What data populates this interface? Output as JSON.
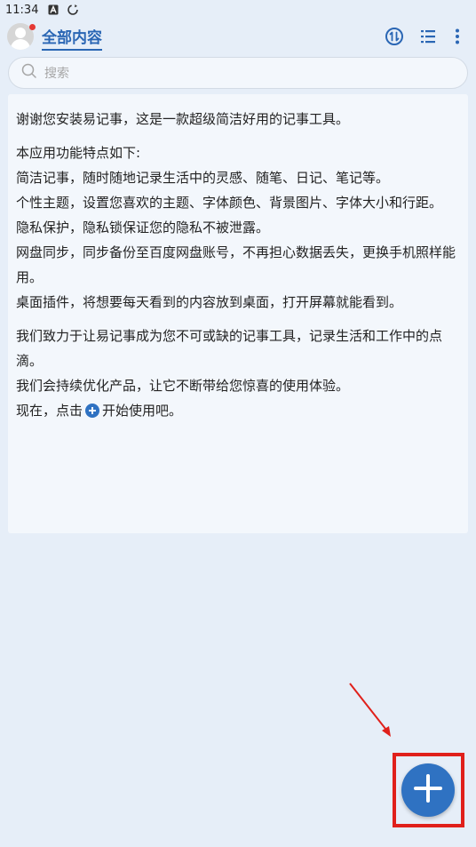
{
  "status_bar": {
    "time": "11:34",
    "icons": [
      "a-icon",
      "sync-icon"
    ]
  },
  "header": {
    "title": "全部内容",
    "has_notification": true,
    "actions": [
      "sort-icon",
      "checklist-icon",
      "more-icon"
    ]
  },
  "search": {
    "placeholder": "搜索"
  },
  "note": {
    "intro": "谢谢您安装易记事，这是一款超级简洁好用的记事工具。",
    "features_heading": "本应用功能特点如下:",
    "features": [
      "简洁记事，随时随地记录生活中的灵感、随笔、日记、笔记等。",
      "个性主题，设置您喜欢的主题、字体颜色、背景图片、字体大小和行距。",
      "隐私保护，隐私锁保证您的隐私不被泄露。",
      "网盘同步，同步备份至百度网盘账号，不再担心数据丢失，更换手机照样能用。",
      "桌面插件，将想要每天看到的内容放到桌面，打开屏幕就能看到。"
    ],
    "closing_1": "我们致力于让易记事成为您不可或缺的记事工具，记录生活和工作中的点滴。",
    "closing_2": "我们会持续优化产品，让它不断带给您惊喜的使用体验。",
    "cta_before": "现在，点击",
    "cta_after": "开始使用吧。"
  },
  "colors": {
    "accent": "#2f72c2",
    "title": "#2a66b4",
    "background": "#e6eef8",
    "card": "#f3f7fc",
    "highlight": "#e0201b"
  }
}
